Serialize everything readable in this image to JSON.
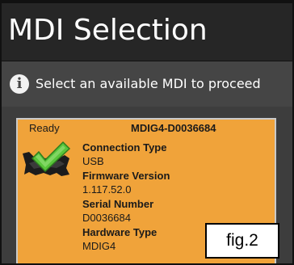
{
  "window": {
    "title": "MDI Selection"
  },
  "info": {
    "icon": "info-icon",
    "icon_glyph": "i",
    "message": "Select an available MDI to proceed"
  },
  "device": {
    "status": "Ready",
    "name": "MDIG4-D0036684",
    "icon": "device-connected-check-icon",
    "fields": {
      "connection_type": {
        "label": "Connection Type",
        "value": "USB"
      },
      "firmware_version": {
        "label": "Firmware Version",
        "value": "1.117.52.0"
      },
      "serial_number": {
        "label": "Serial Number",
        "value": "D0036684"
      },
      "hardware_type": {
        "label": "Hardware Type",
        "value": "MDIG4"
      }
    }
  },
  "figure_label": "fig.2",
  "colors": {
    "titlebar": "#262626",
    "infobar": "#454545",
    "panel": "#3d3d3d",
    "card": "#f0a33a",
    "check": "#58c43a"
  }
}
